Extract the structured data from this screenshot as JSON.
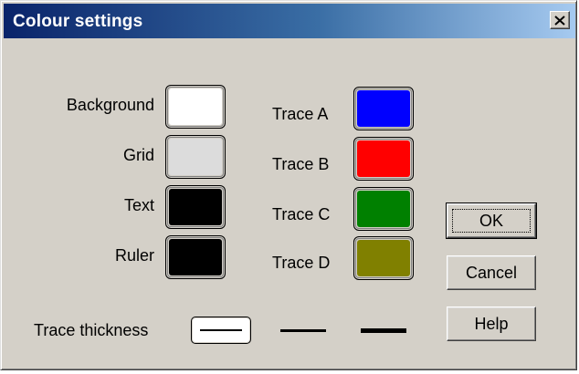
{
  "window": {
    "title": "Colour settings",
    "close_glyph": "✕"
  },
  "left_colors": [
    {
      "label": "Background",
      "color": "#ffffff"
    },
    {
      "label": "Grid",
      "color": "#dcdcdc"
    },
    {
      "label": "Text",
      "color": "#000000"
    },
    {
      "label": "Ruler",
      "color": "#000000"
    }
  ],
  "trace_colors": [
    {
      "label": "Trace A",
      "color": "#0000ff"
    },
    {
      "label": "Trace B",
      "color": "#ff0000"
    },
    {
      "label": "Trace C",
      "color": "#008000"
    },
    {
      "label": "Trace D",
      "color": "#808000"
    }
  ],
  "thickness": {
    "label": "Trace thickness",
    "options": [
      "thin",
      "medium",
      "thick"
    ],
    "selected": "thin"
  },
  "buttons": {
    "ok": "OK",
    "cancel": "Cancel",
    "help": "Help"
  }
}
